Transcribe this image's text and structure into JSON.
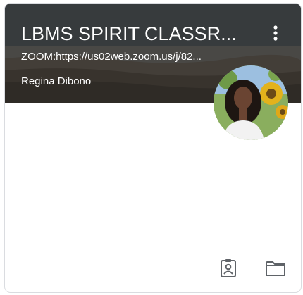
{
  "class_card": {
    "title": "LBMS SPIRIT CLASSR...",
    "section": "ZOOM:https://us02web.zoom.us/j/82...",
    "teacher": "Regina Dibono",
    "more_options_icon": "more-vert-icon",
    "avatar_icon": "teacher-avatar-photo",
    "footer": {
      "icons": [
        "assignment-ind-icon",
        "folder-icon"
      ]
    }
  },
  "colors": {
    "banner_text": "#ffffff",
    "border": "#dadce0",
    "footer_icon": "#5f6368"
  }
}
